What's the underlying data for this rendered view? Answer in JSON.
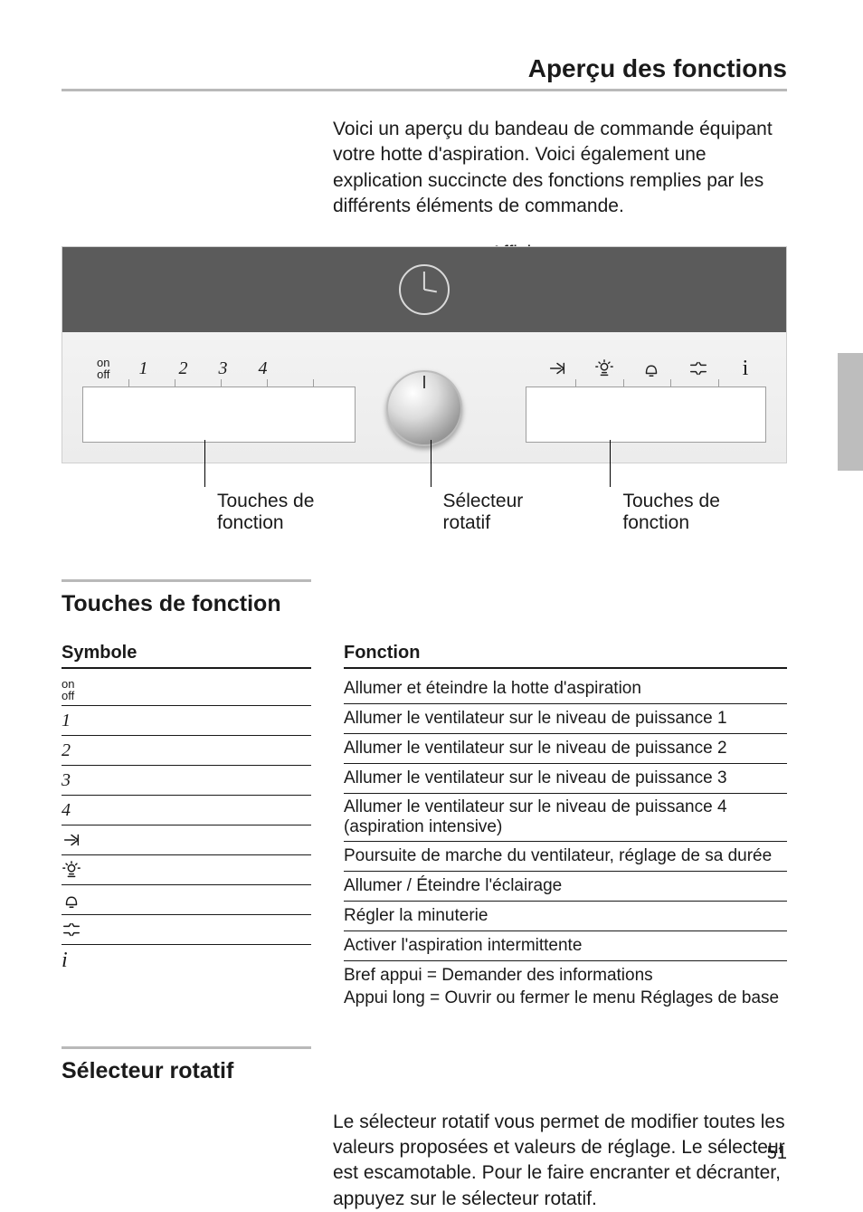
{
  "header": {
    "title": "Aperçu des fonctions"
  },
  "intro": "Voici un aperçu du bandeau de commande équipant votre hotte d'aspiration. Voici également une explication succincte des fonctions remplies par les différents éléments de commande.",
  "figure": {
    "top_label": "Affichage",
    "onoff_top": "on",
    "onoff_bottom": "off",
    "keys_left": [
      "1",
      "2",
      "3",
      "4"
    ],
    "bottom_labels": {
      "left": "Touches de fonction",
      "center": "Sélecteur rotatif",
      "right": "Touches de fonction"
    }
  },
  "section_functions": {
    "heading": "Touches de fonction",
    "col_symbole": "Symbole",
    "col_fonction": "Fonction",
    "rows": [
      {
        "symbol": "on/off",
        "function": "Allumer et éteindre la hotte d'aspiration"
      },
      {
        "symbol": "1",
        "function": "Allumer le ventilateur sur le niveau de puissance 1"
      },
      {
        "symbol": "2",
        "function": "Allumer le ventilateur sur le niveau de puissance 2"
      },
      {
        "symbol": "3",
        "function": "Allumer le ventilateur sur le niveau de puissance 3"
      },
      {
        "symbol": "4",
        "function": "Allumer le ventilateur sur le niveau de puissance 4 (aspiration intensive)"
      },
      {
        "symbol": "runon",
        "function": "Poursuite de marche du ventilateur, réglage de sa durée"
      },
      {
        "symbol": "light",
        "function": "Allumer / Éteindre l'éclairage"
      },
      {
        "symbol": "timer",
        "function": "Régler la minuterie"
      },
      {
        "symbol": "intermittent",
        "function": "Activer l'aspiration intermittente"
      },
      {
        "symbol": "info",
        "function_line1": "Bref appui = Demander des informations",
        "function_line2": "Appui long = Ouvrir ou fermer le menu Réglages de base"
      }
    ]
  },
  "section_rotary": {
    "heading": "Sélecteur rotatif",
    "body": "Le sélecteur rotatif vous permet de modifier toutes les valeurs proposées et valeurs de réglage. Le sélecteur est escamotable. Pour le faire encranter et décranter, appuyez sur le sélecteur rotatif."
  },
  "page_number": "51"
}
